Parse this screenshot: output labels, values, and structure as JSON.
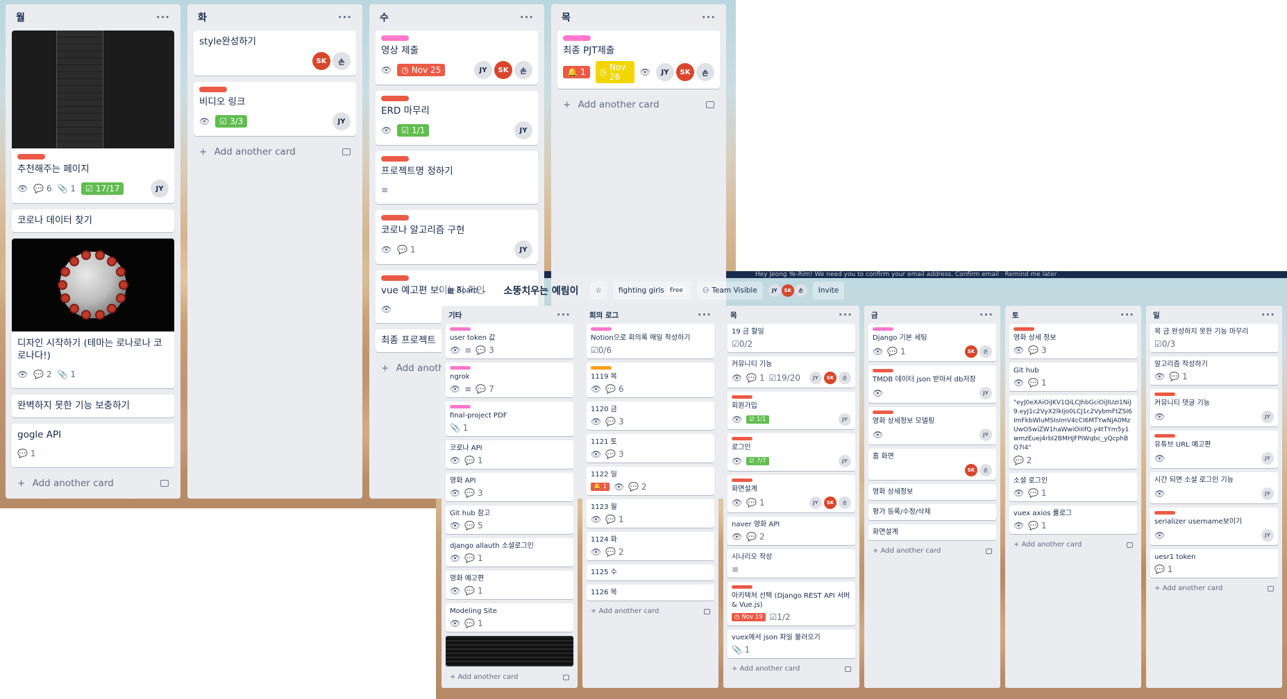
{
  "back": {
    "lists": [
      {
        "name": "월",
        "cards": [
          {
            "kind": "cover-dark",
            "label": "red",
            "title": "추천해주는 페이지",
            "watch": true,
            "comments": "6",
            "attachments": "1",
            "checklist": "17/17",
            "checklist_done": true,
            "members": [
              "JY"
            ]
          },
          {
            "title": "코로나 데이터 찾기"
          },
          {
            "kind": "cover-virus",
            "title": "디자인 시작하기 (테마는 로나로나 코로나다!)",
            "watch": true,
            "comments": "2",
            "attachments": "1"
          },
          {
            "title": "완벽하지 못한 기능 보충하기"
          },
          {
            "title": "gogle API",
            "comments": "1"
          }
        ]
      },
      {
        "name": "화",
        "cards": [
          {
            "title": "style완성하기",
            "members": [
              "SK",
              "손"
            ]
          },
          {
            "label": "red",
            "title": "비디오 링크",
            "watch": true,
            "checklist": "3/3",
            "checklist_done": true,
            "members": [
              "JY"
            ]
          }
        ]
      },
      {
        "name": "수",
        "cards": [
          {
            "label": "pink",
            "title": "영상 제출",
            "watch": true,
            "due": "Nov 25",
            "due_color": "red",
            "members": [
              "JY",
              "SK",
              "손"
            ]
          },
          {
            "label": "red",
            "title": "ERD 마무리",
            "watch": true,
            "checklist": "1/1",
            "checklist_done": true,
            "members": [
              "JY"
            ]
          },
          {
            "label": "red",
            "title": "프로젝트명 정하기",
            "description": true
          },
          {
            "label": "red",
            "title": "코로나 알고리즘 구현",
            "watch": true,
            "comments": "1",
            "members": [
              "JY"
            ]
          },
          {
            "label": "red",
            "title": "vue 예고편 보이는지 확인",
            "watch": true
          },
          {
            "title": "최종 프로젝트"
          }
        ]
      },
      {
        "name": "목",
        "cards": [
          {
            "label": "pink",
            "title": "최종 PJT제출",
            "alarm": "1",
            "watch": true,
            "due": "Nov 26",
            "due_color": "yellow",
            "members": [
              "JY",
              "SK",
              "손"
            ]
          }
        ]
      }
    ],
    "add_card": "Add another card",
    "add_card_short": "Add anothe"
  },
  "front": {
    "banner": "Hey Jeong Ye-Rim! We need you to confirm your email address.   Confirm email  ·  Remind me later",
    "board_button": "Board",
    "board_title": "소뚱치우는 예림이",
    "team": "fighting girls",
    "team_tag": "Free",
    "visibility": "Team Visible",
    "invite": "Invite",
    "members": [
      "JY",
      "SK",
      "손"
    ],
    "add_card": "Add another card",
    "lists": [
      {
        "name": "기타",
        "cards": [
          {
            "label": "pink",
            "title": "user token 값",
            "watch": true,
            "desc": true,
            "comments": "3"
          },
          {
            "label": "pink",
            "title": "ngrok",
            "watch": true,
            "desc": true,
            "comments": "7"
          },
          {
            "label": "pink",
            "title": "final-project PDF",
            "attachments": "1"
          },
          {
            "title": "코로나 API",
            "watch": true,
            "comments": "1"
          },
          {
            "title": "영화 API",
            "watch": true,
            "comments": "3"
          },
          {
            "title": "Git hub 참고",
            "watch": true,
            "comments": "5"
          },
          {
            "title": "django allauth 소셜로그인",
            "watch": true,
            "comments": "1"
          },
          {
            "title": "영화 예고편",
            "watch": true,
            "comments": "1"
          },
          {
            "title": "Modeling Site",
            "watch": true,
            "comments": "1"
          },
          {
            "kind": "cover"
          }
        ]
      },
      {
        "name": "회의 로그",
        "cards": [
          {
            "label": "pink",
            "title": "Notion으로 회의록 매일 작성하기",
            "checklist": "0/6"
          },
          {
            "label": "orange",
            "title": "1119 목",
            "watch": true,
            "comments": "6"
          },
          {
            "title": "1120 금",
            "watch": true,
            "comments": "3"
          },
          {
            "title": "1121 토",
            "watch": true,
            "comments": "3"
          },
          {
            "title": "1122 일",
            "alarm": "1",
            "watch": true,
            "comments": "2"
          },
          {
            "title": "1123 월",
            "watch": true,
            "comments": "1"
          },
          {
            "title": "1124 화",
            "watch": true,
            "comments": "2"
          },
          {
            "title": "1125 수"
          },
          {
            "title": "1126 목"
          }
        ]
      },
      {
        "name": "목",
        "cards": [
          {
            "title": "19 금 할일",
            "checklist": "0/2"
          },
          {
            "title": "커뮤니티 기능",
            "watch": true,
            "comments": "1",
            "checklist": "19/20",
            "members": [
              "JY",
              "SK",
              "손"
            ]
          },
          {
            "label": "red",
            "title": "회원가입",
            "watch": true,
            "checklist": "1/1",
            "checklist_done": true,
            "members": [
              "JY"
            ]
          },
          {
            "label": "red",
            "title": "로그인",
            "watch": true,
            "checklist": "7/7",
            "checklist_done": true,
            "members": [
              "JY"
            ]
          },
          {
            "label": "red",
            "title": "화면설계",
            "watch": true,
            "comments": "1",
            "members": [
              "JY",
              "SK",
              "손"
            ]
          },
          {
            "title": "naver 영화 API",
            "watch": true,
            "comments": "2"
          },
          {
            "title": "시나리오 작성",
            "desc": true
          },
          {
            "label": "red",
            "title": "아키텍처 선택 (Django REST API 서버 & Vue.js)",
            "due": "Nov 19",
            "due_color": "red",
            "checklist": "1/2"
          },
          {
            "title": "vuex에서 json 파일 불러오기",
            "attachments": "1"
          }
        ]
      },
      {
        "name": "금",
        "cards": [
          {
            "label": "pink",
            "title": "Django 기본 세팅",
            "watch": true,
            "comments": "1",
            "members": [
              "SK",
              "손"
            ]
          },
          {
            "label": "red",
            "title": "TMDB 데이터 json 받아서 db저장",
            "watch": true,
            "members": [
              "JY"
            ]
          },
          {
            "label": "red",
            "title": "영화 상세정보 모델링",
            "watch": true,
            "members": [
              "JY"
            ]
          },
          {
            "title": "홈 화면",
            "members": [
              "SK",
              "손"
            ]
          },
          {
            "title": "영화 상세정보"
          },
          {
            "title": "평가 등록/수정/삭제"
          },
          {
            "title": "화면설계"
          }
        ]
      },
      {
        "name": "토",
        "cards": [
          {
            "label": "red",
            "title": "영화 상세 정보",
            "watch": true,
            "comments": "3"
          },
          {
            "title": "Git hub",
            "watch": true,
            "comments": "1"
          },
          {
            "title": "\"eyJ0eXAiOiJKV1QiLCJhbGciOiJIUzI1NiJ9.eyJ1c2VyX2lkIjo0LCJ1c2VybmFtZSI6ImFkbWluMSIsImV4cCI6MTYwNjA0MzUwOSwiZW1haWwiOiIifQ.y4tTYm5y1wmzEuej4rbI2BMHJFPIWqbc_yQcphBQ7I4\"",
            "token": true,
            "comments": "2"
          },
          {
            "title": "소셜 로그인",
            "watch": true,
            "comments": "1"
          },
          {
            "title": "vuex axios 률로그",
            "watch": true,
            "comments": "1"
          }
        ]
      },
      {
        "name": "일",
        "cards": [
          {
            "title": "목 금 완성하지 못한 기능 마무리",
            "checklist": "0/3"
          },
          {
            "title": "알고리즘 작성하기",
            "watch": true,
            "comments": "1"
          },
          {
            "label": "red",
            "title": "커뮤니티 댓글 기능",
            "watch": true,
            "members": [
              "JY"
            ]
          },
          {
            "label": "red",
            "title": "유튜브 URL 예고편",
            "watch": true,
            "members": [
              "JY"
            ]
          },
          {
            "title": "시간 되면 소셜 로그인 기능",
            "watch": true,
            "members": [
              "JY"
            ]
          },
          {
            "label": "red",
            "title": "serializer username보이기",
            "watch": true,
            "members": [
              "JY"
            ]
          },
          {
            "title": "uesr1 token",
            "comments": "1"
          }
        ]
      }
    ]
  },
  "colors": {
    "red": "#eb5a46",
    "pink": "#ff78cb",
    "orange": "#ff9f1a",
    "green": "#61bd4f",
    "yellow": "#f2d600",
    "sk": "#d8462c",
    "list_bg": "#ebecf0"
  },
  "icons": [
    "eye-icon",
    "comment-icon",
    "paperclip-icon",
    "checklist-icon",
    "clock-icon",
    "bell-icon",
    "description-icon",
    "plus-icon",
    "template-icon",
    "star-icon",
    "menu-dots-icon",
    "board-icon",
    "team-icon"
  ]
}
